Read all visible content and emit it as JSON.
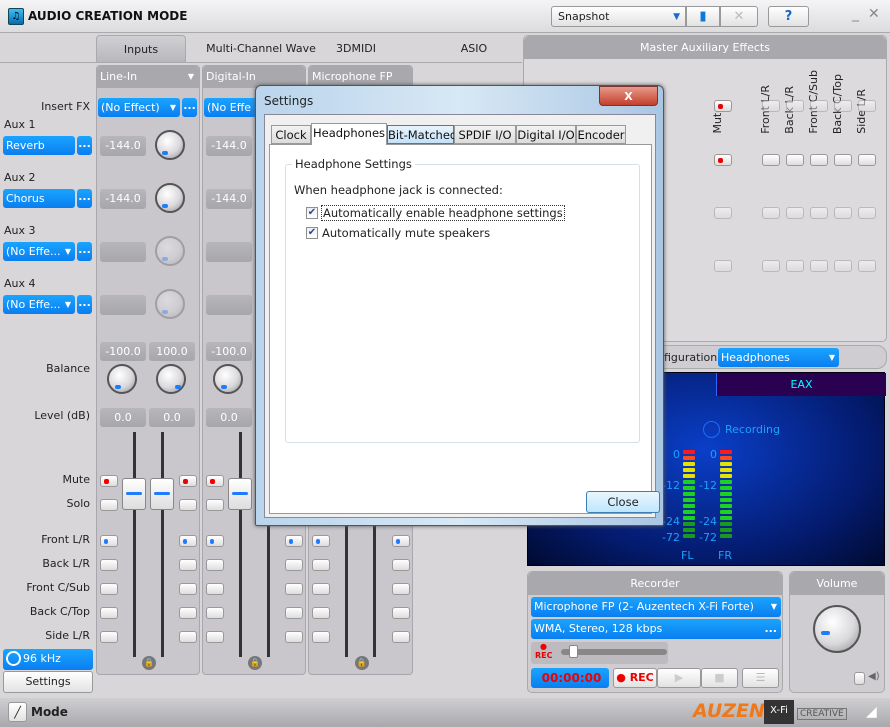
{
  "app": {
    "title": "AUDIO CREATION MODE",
    "snapshot": "Snapshot",
    "help": "?",
    "mode_label": "Mode"
  },
  "tabs": [
    "Inputs",
    "Multi-Channel Wave",
    "3DMIDI",
    "ASIO"
  ],
  "labels": {
    "insert_fx": "Insert FX",
    "aux1": "Aux 1",
    "aux2": "Aux 2",
    "aux3": "Aux 3",
    "aux4": "Aux 4",
    "balance": "Balance",
    "level": "Level (dB)",
    "mute": "Mute",
    "solo": "Solo",
    "front_lr": "Front L/R",
    "back_lr": "Back L/R",
    "front_csub": "Front C/Sub",
    "back_ctop": "Back C/Top",
    "side_lr": "Side L/R"
  },
  "aux_selects": [
    "Reverb",
    "Chorus",
    "(No Effe...",
    "(No Effe..."
  ],
  "sample_rate": "96 kHz",
  "settings_button": "Settings",
  "strips": [
    {
      "name": "Line-In",
      "insert_fx": "(No Effect)",
      "aux": [
        "-144.0",
        "-144.0"
      ],
      "balance": [
        "-100.0",
        "100.0"
      ],
      "level": [
        "0.0",
        "0.0"
      ]
    },
    {
      "name": "Digital-In",
      "insert_fx": "(No Effe",
      "aux": [
        "-144.0",
        "-144.0"
      ],
      "balance": [
        "-100.0"
      ],
      "level": [
        "0.0"
      ]
    },
    {
      "name": "Microphone FP",
      "insert_fx": "",
      "aux": [],
      "balance": [],
      "level": []
    }
  ],
  "master": {
    "title": "Master Auxiliary Effects",
    "columns": [
      "Mute",
      "Front L/R",
      "Back L/R",
      "Front C/Sub",
      "Back C/Top",
      "Side L/R"
    ]
  },
  "config": {
    "label": "figuration:",
    "value": "Headphones"
  },
  "display": {
    "tab": "EAX",
    "recording": "Recording",
    "meter_ticks": [
      "0",
      "-12",
      "-24",
      "-72"
    ],
    "channels": [
      "FL",
      "FR"
    ]
  },
  "recorder": {
    "title": "Recorder",
    "source": "Microphone FP (2- Auzentech X-Fi Forte)",
    "format": "WMA, Stereo, 128 kbps",
    "rec_small": "REC",
    "time": "00:00:00",
    "rec_button": "REC"
  },
  "volume": {
    "title": "Volume"
  },
  "dialog": {
    "title": "Settings",
    "tabs": [
      "Clock",
      "Headphones",
      "Bit-Matched",
      "SPDIF I/O",
      "Digital I/O",
      "Encoder"
    ],
    "active_tab": "Headphones",
    "group_title": "Headphone Settings",
    "prompt": "When headphone jack is connected:",
    "options": [
      {
        "label": "Automatically enable headphone settings",
        "checked": true
      },
      {
        "label": "Automatically mute speakers",
        "checked": true
      }
    ],
    "close": "Close"
  },
  "logos": {
    "brand": "AUZEN",
    "xfi": "X-Fi",
    "creative": "CREATIVE"
  },
  "colors": {
    "accent": "#0a8cf8",
    "rec_red": "#e00000",
    "display_bg": "#041b6e"
  }
}
